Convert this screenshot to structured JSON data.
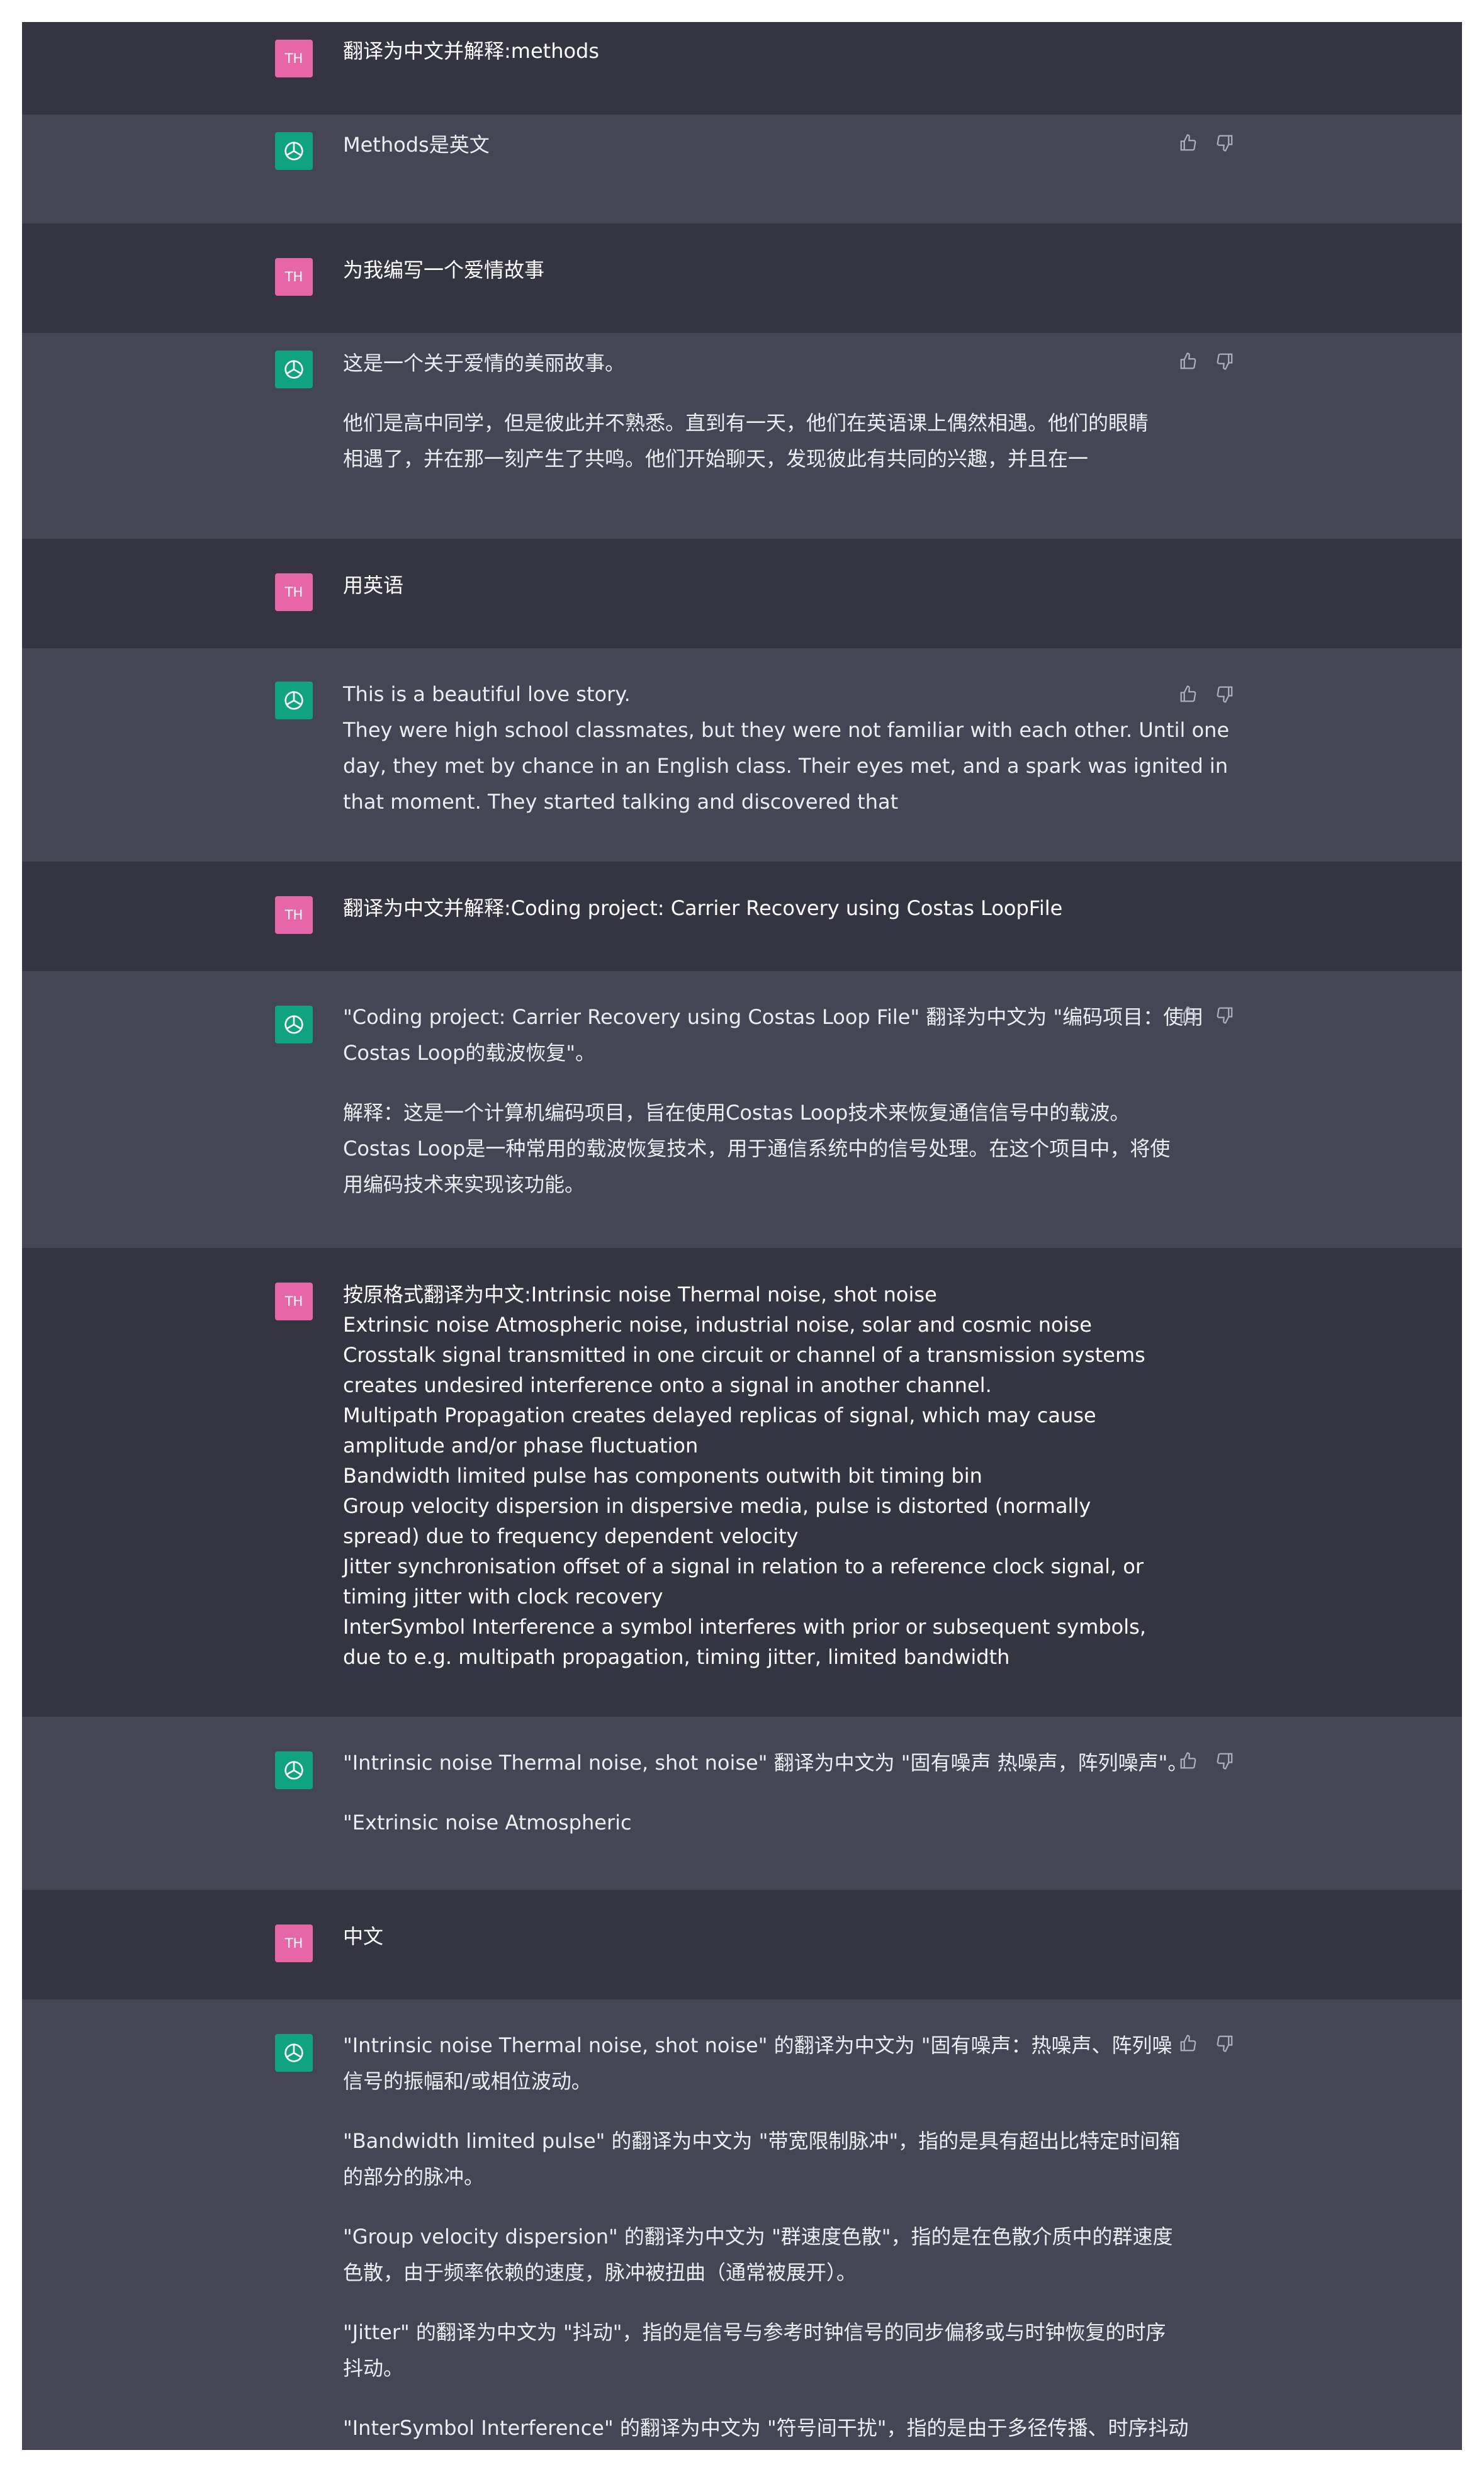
{
  "theme": {
    "user_bg": "#343541",
    "assistant_bg": "#444654",
    "user_avatar": "#e766a8",
    "assistant_avatar": "#10a37f",
    "text": "#ececf1"
  },
  "user_initials": "TH",
  "messages": [
    {
      "role": "user",
      "lines": [
        "翻译为中文并解释:methods"
      ]
    },
    {
      "role": "assistant",
      "lines": [
        "Methods是英文"
      ]
    },
    {
      "role": "user",
      "lines": [
        "为我编写一个爱情故事"
      ]
    },
    {
      "role": "assistant",
      "lines": [
        "这是一个关于爱情的美丽故事。",
        "他们是高中同学，但是彼此并不熟悉。直到有一天，他们在英语课上偶然相遇。他们的眼睛",
        "相遇了，并在那一刻产生了共鸣。他们开始聊天，发现彼此有共同的兴趣，并且在一"
      ]
    },
    {
      "role": "user",
      "lines": [
        "用英语"
      ]
    },
    {
      "role": "assistant",
      "lines": [
        "This is a beautiful love story.",
        "They were high school classmates, but they were not familiar with each other. Until one",
        "day, they met by chance in an English class. Their eyes met, and a spark was ignited in",
        "that moment. They started talking and discovered that"
      ]
    },
    {
      "role": "user",
      "lines": [
        "翻译为中文并解释:Coding project: Carrier Recovery using Costas LoopFile"
      ]
    },
    {
      "role": "assistant",
      "lines": [
        "\"Coding project: Carrier Recovery using Costas Loop File\" 翻译为中文为 \"编码项目：使用",
        "Costas Loop的载波恢复\"。",
        "解释：这是一个计算机编码项目，旨在使用Costas Loop技术来恢复通信信号中的载波。",
        "Costas Loop是一种常用的载波恢复技术，用于通信系统中的信号处理。在这个项目中，将使",
        "用编码技术来实现该功能。"
      ]
    },
    {
      "role": "user",
      "lines": [
        "按原格式翻译为中文:Intrinsic noise Thermal noise, shot noise",
        "Extrinsic noise Atmospheric noise, industrial noise, solar and cosmic noise",
        "Crosstalk signal transmitted in one circuit or channel of a transmission systems",
        "creates undesired interference onto a signal in another channel.",
        "Multipath Propagation creates delayed replicas of signal, which may cause",
        "amplitude and/or phase fluctuation",
        "Bandwidth limited pulse has components outwith bit timing bin",
        "Group velocity dispersion in dispersive media, pulse is distorted (normally",
        "spread) due to frequency dependent velocity",
        "Jitter synchronisation offset of a signal in relation to a reference clock signal, or",
        "timing jitter with clock recovery",
        "InterSymbol Interference a symbol interferes with prior or subsequent symbols,",
        "due to e.g. multipath propagation, timing jitter, limited bandwidth"
      ]
    },
    {
      "role": "assistant",
      "lines": [
        "\"Intrinsic noise Thermal noise, shot noise\" 翻译为中文为 \"固有噪声 热噪声，阵列噪声\"。",
        "\"Extrinsic noise Atmospheric"
      ]
    },
    {
      "role": "user",
      "lines": [
        "中文"
      ]
    },
    {
      "role": "assistant",
      "lines": [
        "\"Intrinsic noise Thermal noise, shot noise\" 的翻译为中文为 \"固有噪声：热噪声、阵列噪",
        "信号的振幅和/或相位波动。",
        "\"Bandwidth limited pulse\" 的翻译为中文为 \"带宽限制脉冲\"，指的是具有超出比特定时间箱",
        "的部分的脉冲。",
        "\"Group velocity dispersion\" 的翻译为中文为 \"群速度色散\"，指的是在色散介质中的群速度",
        "色散，由于频率依赖的速度，脉冲被扭曲（通常被展开）。",
        "\"Jitter\" 的翻译为中文为 \"抖动\"，指的是信号与参考时钟信号的同步偏移或与时钟恢复的时序",
        "抖动。",
        "\"InterSymbol Interference\" 的翻译为中文为 \"符号间干扰\"，指的是由于多径传播、时序抖动"
      ]
    }
  ],
  "icons": {
    "user": "avatar-initials",
    "assistant": "openai-logo-icon",
    "feedback": [
      "thumbs-up-icon",
      "thumbs-down-icon"
    ]
  }
}
